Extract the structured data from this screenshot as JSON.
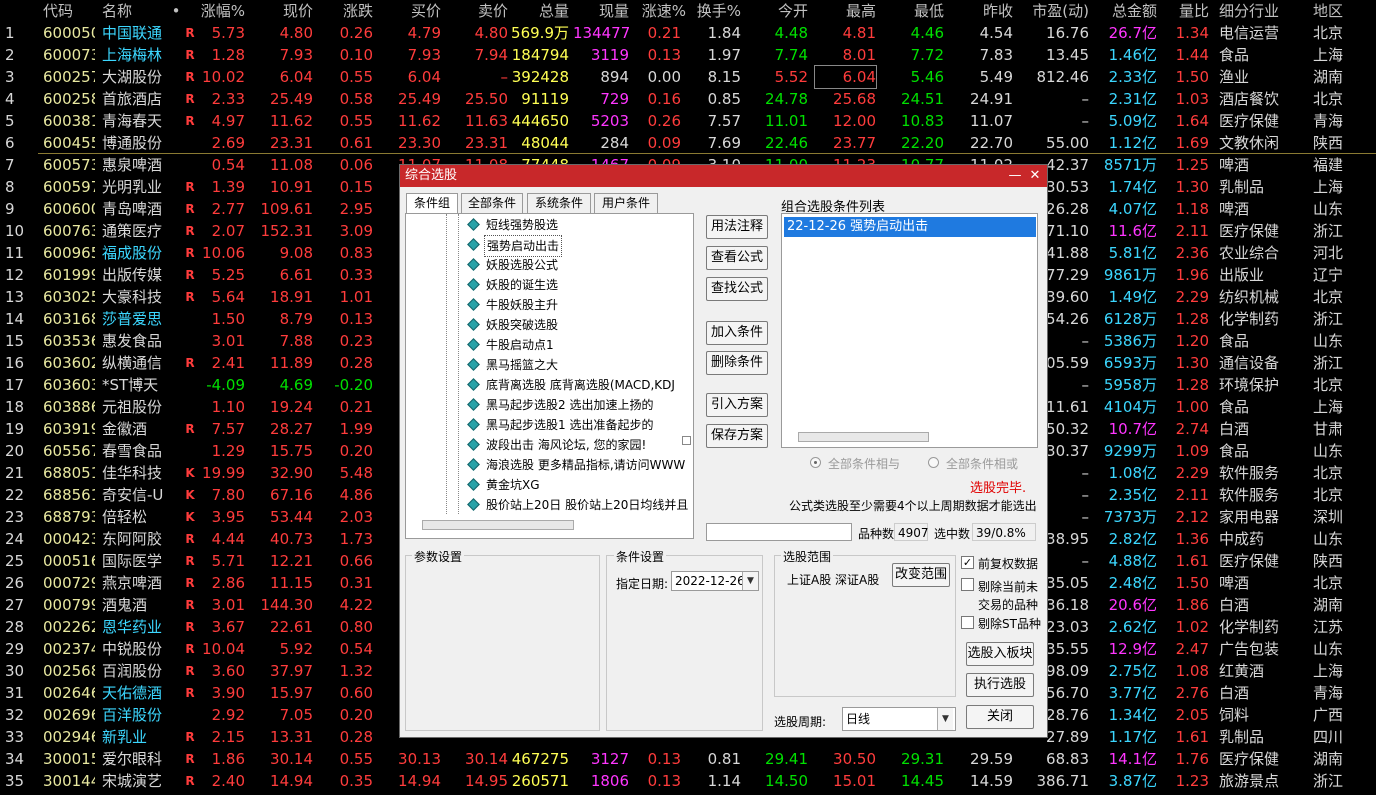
{
  "columns": [
    "代码",
    "名称",
    "•",
    "涨幅%",
    "现价",
    "涨跌",
    "买价",
    "卖价",
    "总量",
    "现量",
    "涨速%",
    "换手%",
    "今开",
    "最高",
    "最低",
    "昨收",
    "市盈(动)",
    "总金额",
    "量比",
    "细分行业",
    "地区"
  ],
  "rows": [
    {
      "n": "1",
      "code": "600050",
      "name": "中国联通",
      "tag": "R",
      "chg": "5.73",
      "price": "4.80",
      "diff": "0.26",
      "bid": "4.79",
      "ask": "4.80",
      "vol": "569.9万",
      "cur": "134477",
      "spd": "0.21",
      "turn": "1.84",
      "open": "4.48",
      "high": "4.81",
      "low": "4.46",
      "prev": "4.54",
      "pe": "16.76",
      "amt": "26.7亿",
      "vr": "1.34",
      "ind": "电信运营",
      "reg": "北京"
    },
    {
      "n": "2",
      "code": "600073",
      "name": "上海梅林",
      "tag": "R",
      "chg": "1.28",
      "price": "7.93",
      "diff": "0.10",
      "bid": "7.93",
      "ask": "7.94",
      "vol": "184794",
      "cur": "3119",
      "spd": "0.13",
      "turn": "1.97",
      "open": "7.74",
      "high": "8.01",
      "low": "7.72",
      "prev": "7.83",
      "pe": "13.45",
      "amt": "1.46亿",
      "vr": "1.44",
      "ind": "食品",
      "reg": "上海"
    },
    {
      "n": "3",
      "code": "600257",
      "name": "大湖股份",
      "tag": "R",
      "chg": "10.02",
      "price": "6.04",
      "diff": "0.55",
      "bid": "6.04",
      "ask": "–",
      "vol": "392428",
      "cur": "894",
      "spd": "0.00",
      "turn": "8.15",
      "open": "5.52",
      "high": "6.04",
      "low": "5.46",
      "prev": "5.49",
      "pe": "812.46",
      "amt": "2.33亿",
      "vr": "1.50",
      "ind": "渔业",
      "reg": "湖南"
    },
    {
      "n": "4",
      "code": "600258",
      "name": "首旅酒店",
      "tag": "R",
      "chg": "2.33",
      "price": "25.49",
      "diff": "0.58",
      "bid": "25.49",
      "ask": "25.50",
      "vol": "91119",
      "cur": "729",
      "spd": "0.16",
      "turn": "0.85",
      "open": "24.78",
      "high": "25.68",
      "low": "24.51",
      "prev": "24.91",
      "pe": "–",
      "amt": "2.31亿",
      "vr": "1.03",
      "ind": "酒店餐饮",
      "reg": "北京"
    },
    {
      "n": "5",
      "code": "600381",
      "name": "青海春天",
      "tag": "R",
      "chg": "4.97",
      "price": "11.62",
      "diff": "0.55",
      "bid": "11.62",
      "ask": "11.63",
      "vol": "444650",
      "cur": "5203",
      "spd": "0.26",
      "turn": "7.57",
      "open": "11.01",
      "high": "12.00",
      "low": "10.83",
      "prev": "11.07",
      "pe": "–",
      "amt": "5.09亿",
      "vr": "1.64",
      "ind": "医疗保健",
      "reg": "青海"
    },
    {
      "n": "6",
      "code": "600455",
      "name": "博通股份",
      "tag": "",
      "chg": "2.69",
      "price": "23.31",
      "diff": "0.61",
      "bid": "23.30",
      "ask": "23.31",
      "vol": "48044",
      "cur": "284",
      "spd": "0.09",
      "turn": "7.69",
      "open": "22.46",
      "high": "23.77",
      "low": "22.20",
      "prev": "22.70",
      "pe": "55.00",
      "amt": "1.12亿",
      "vr": "1.69",
      "ind": "文教休闲",
      "reg": "陕西"
    },
    {
      "n": "7",
      "code": "600573",
      "name": "惠泉啤酒",
      "tag": "",
      "chg": "0.54",
      "price": "11.08",
      "diff": "0.06",
      "bid": "11.07",
      "ask": "11.08",
      "vol": "77448",
      "cur": "1467",
      "spd": "0.09",
      "turn": "3.10",
      "open": "11.00",
      "high": "11.23",
      "low": "10.77",
      "prev": "11.02",
      "pe": "42.37",
      "amt": "8571万",
      "vr": "1.25",
      "ind": "啤酒",
      "reg": "福建"
    },
    {
      "n": "8",
      "code": "600597",
      "name": "光明乳业",
      "tag": "R",
      "chg": "1.39",
      "price": "10.91",
      "diff": "0.15",
      "bid": "",
      "ask": "",
      "vol": "",
      "cur": "",
      "spd": "",
      "turn": "",
      "open": "",
      "high": "",
      "low": "",
      "prev": "",
      "pe": "30.53",
      "amt": "1.74亿",
      "vr": "1.30",
      "ind": "乳制品",
      "reg": "上海"
    },
    {
      "n": "9",
      "code": "600600",
      "name": "青岛啤酒",
      "tag": "R",
      "chg": "2.77",
      "price": "109.61",
      "diff": "2.95",
      "bid": "",
      "ask": "",
      "vol": "",
      "cur": "",
      "spd": "",
      "turn": "",
      "open": "",
      "high": "",
      "low": "",
      "prev": "",
      "pe": "26.28",
      "amt": "4.07亿",
      "vr": "1.18",
      "ind": "啤酒",
      "reg": "山东"
    },
    {
      "n": "10",
      "code": "600763",
      "name": "通策医疗",
      "tag": "R",
      "chg": "2.07",
      "price": "152.31",
      "diff": "3.09",
      "bid": "",
      "ask": "",
      "vol": "",
      "cur": "",
      "spd": "",
      "turn": "",
      "open": "",
      "high": "",
      "low": "",
      "prev": "",
      "pe": "71.10",
      "amt": "11.6亿",
      "vr": "2.11",
      "ind": "医疗保健",
      "reg": "浙江"
    },
    {
      "n": "11",
      "code": "600965",
      "name": "福成股份",
      "tag": "R",
      "chg": "10.06",
      "price": "9.08",
      "diff": "0.83",
      "bid": "",
      "ask": "",
      "vol": "",
      "cur": "",
      "spd": "",
      "turn": "",
      "open": "",
      "high": "",
      "low": "",
      "prev": "",
      "pe": "41.88",
      "amt": "5.81亿",
      "vr": "2.36",
      "ind": "农业综合",
      "reg": "河北"
    },
    {
      "n": "12",
      "code": "601999",
      "name": "出版传媒",
      "tag": "R",
      "chg": "5.25",
      "price": "6.61",
      "diff": "0.33",
      "bid": "",
      "ask": "",
      "vol": "",
      "cur": "",
      "spd": "",
      "turn": "",
      "open": "",
      "high": "",
      "low": "",
      "prev": "",
      "pe": "77.29",
      "amt": "9861万",
      "vr": "1.96",
      "ind": "出版业",
      "reg": "辽宁"
    },
    {
      "n": "13",
      "code": "603025",
      "name": "大豪科技",
      "tag": "R",
      "chg": "5.64",
      "price": "18.91",
      "diff": "1.01",
      "bid": "",
      "ask": "",
      "vol": "",
      "cur": "",
      "spd": "",
      "turn": "",
      "open": "",
      "high": "",
      "low": "",
      "prev": "",
      "pe": "39.60",
      "amt": "1.49亿",
      "vr": "2.29",
      "ind": "纺织机械",
      "reg": "北京"
    },
    {
      "n": "14",
      "code": "603168",
      "name": "莎普爱思",
      "tag": "",
      "chg": "1.50",
      "price": "8.79",
      "diff": "0.13",
      "bid": "",
      "ask": "",
      "vol": "",
      "cur": "",
      "spd": "",
      "turn": "",
      "open": "",
      "high": "",
      "low": "",
      "prev": "",
      "pe": "54.26",
      "amt": "6128万",
      "vr": "1.28",
      "ind": "化学制药",
      "reg": "浙江"
    },
    {
      "n": "15",
      "code": "603536",
      "name": "惠发食品",
      "tag": "",
      "chg": "3.01",
      "price": "7.88",
      "diff": "0.23",
      "bid": "",
      "ask": "",
      "vol": "",
      "cur": "",
      "spd": "",
      "turn": "",
      "open": "",
      "high": "",
      "low": "",
      "prev": "",
      "pe": "–",
      "amt": "5386万",
      "vr": "1.20",
      "ind": "食品",
      "reg": "山东"
    },
    {
      "n": "16",
      "code": "603602",
      "name": "纵横通信",
      "tag": "R",
      "chg": "2.41",
      "price": "11.89",
      "diff": "0.28",
      "bid": "",
      "ask": "",
      "vol": "",
      "cur": "",
      "spd": "",
      "turn": "",
      "open": "",
      "high": "",
      "low": "",
      "prev": "",
      "pe": "105.59",
      "amt": "6593万",
      "vr": "1.30",
      "ind": "通信设备",
      "reg": "浙江"
    },
    {
      "n": "17",
      "code": "603603",
      "name": "*ST博天",
      "tag": "",
      "chg": "-4.09",
      "price": "4.69",
      "diff": "-0.20",
      "bid": "",
      "ask": "",
      "vol": "",
      "cur": "",
      "spd": "",
      "turn": "",
      "open": "",
      "high": "",
      "low": "",
      "prev": "",
      "pe": "–",
      "amt": "5958万",
      "vr": "1.28",
      "ind": "环境保护",
      "reg": "北京"
    },
    {
      "n": "18",
      "code": "603886",
      "name": "元祖股份",
      "tag": "",
      "chg": "1.10",
      "price": "19.24",
      "diff": "0.21",
      "bid": "",
      "ask": "",
      "vol": "",
      "cur": "",
      "spd": "",
      "turn": "",
      "open": "",
      "high": "",
      "low": "",
      "prev": "",
      "pe": "11.61",
      "amt": "4104万",
      "vr": "1.00",
      "ind": "食品",
      "reg": "上海"
    },
    {
      "n": "19",
      "code": "603919",
      "name": "金徽酒",
      "tag": "R",
      "chg": "7.57",
      "price": "28.27",
      "diff": "1.99",
      "bid": "",
      "ask": "",
      "vol": "",
      "cur": "",
      "spd": "",
      "turn": "",
      "open": "",
      "high": "",
      "low": "",
      "prev": "",
      "pe": "50.32",
      "amt": "10.7亿",
      "vr": "2.74",
      "ind": "白酒",
      "reg": "甘肃"
    },
    {
      "n": "20",
      "code": "605567",
      "name": "春雪食品",
      "tag": "",
      "chg": "1.29",
      "price": "15.75",
      "diff": "0.20",
      "bid": "",
      "ask": "",
      "vol": "",
      "cur": "",
      "spd": "",
      "turn": "",
      "open": "",
      "high": "",
      "low": "",
      "prev": "",
      "pe": "30.37",
      "amt": "9299万",
      "vr": "1.09",
      "ind": "食品",
      "reg": "山东"
    },
    {
      "n": "21",
      "code": "688051",
      "name": "佳华科技",
      "tag": "K",
      "chg": "19.99",
      "price": "32.90",
      "diff": "5.48",
      "bid": "",
      "ask": "",
      "vol": "",
      "cur": "",
      "spd": "",
      "turn": "",
      "open": "",
      "high": "",
      "low": "",
      "prev": "",
      "pe": "–",
      "amt": "1.08亿",
      "vr": "2.29",
      "ind": "软件服务",
      "reg": "北京"
    },
    {
      "n": "22",
      "code": "688561",
      "name": "奇安信-U",
      "tag": "K",
      "chg": "7.80",
      "price": "67.16",
      "diff": "4.86",
      "bid": "",
      "ask": "",
      "vol": "",
      "cur": "",
      "spd": "",
      "turn": "",
      "open": "",
      "high": "",
      "low": "",
      "prev": "",
      "pe": "–",
      "amt": "2.35亿",
      "vr": "2.11",
      "ind": "软件服务",
      "reg": "北京"
    },
    {
      "n": "23",
      "code": "688793",
      "name": "倍轻松",
      "tag": "K",
      "chg": "3.95",
      "price": "53.44",
      "diff": "2.03",
      "bid": "",
      "ask": "",
      "vol": "",
      "cur": "",
      "spd": "",
      "turn": "",
      "open": "",
      "high": "",
      "low": "",
      "prev": "",
      "pe": "–",
      "amt": "7373万",
      "vr": "2.12",
      "ind": "家用电器",
      "reg": "深圳"
    },
    {
      "n": "24",
      "code": "000423",
      "name": "东阿阿胶",
      "tag": "R",
      "chg": "4.44",
      "price": "40.73",
      "diff": "1.73",
      "bid": "",
      "ask": "",
      "vol": "",
      "cur": "",
      "spd": "",
      "turn": "",
      "open": "",
      "high": "",
      "low": "",
      "prev": "",
      "pe": "38.95",
      "amt": "2.82亿",
      "vr": "1.36",
      "ind": "中成药",
      "reg": "山东"
    },
    {
      "n": "25",
      "code": "000516",
      "name": "国际医学",
      "tag": "R",
      "chg": "5.71",
      "price": "12.21",
      "diff": "0.66",
      "bid": "",
      "ask": "",
      "vol": "",
      "cur": "",
      "spd": "",
      "turn": "",
      "open": "",
      "high": "",
      "low": "",
      "prev": "",
      "pe": "–",
      "amt": "4.88亿",
      "vr": "1.61",
      "ind": "医疗保健",
      "reg": "陕西"
    },
    {
      "n": "26",
      "code": "000729",
      "name": "燕京啤酒",
      "tag": "R",
      "chg": "2.86",
      "price": "11.15",
      "diff": "0.31",
      "bid": "",
      "ask": "",
      "vol": "",
      "cur": "",
      "spd": "",
      "turn": "",
      "open": "",
      "high": "",
      "low": "",
      "prev": "",
      "pe": "35.05",
      "amt": "2.48亿",
      "vr": "1.50",
      "ind": "啤酒",
      "reg": "北京"
    },
    {
      "n": "27",
      "code": "000799",
      "name": "酒鬼酒",
      "tag": "R",
      "chg": "3.01",
      "price": "144.30",
      "diff": "4.22",
      "bid": "",
      "ask": "",
      "vol": "",
      "cur": "",
      "spd": "",
      "turn": "",
      "open": "",
      "high": "",
      "low": "",
      "prev": "",
      "pe": "36.18",
      "amt": "20.6亿",
      "vr": "1.86",
      "ind": "白酒",
      "reg": "湖南"
    },
    {
      "n": "28",
      "code": "002262",
      "name": "恩华药业",
      "tag": "R",
      "chg": "3.67",
      "price": "22.61",
      "diff": "0.80",
      "bid": "",
      "ask": "",
      "vol": "",
      "cur": "",
      "spd": "",
      "turn": "",
      "open": "",
      "high": "",
      "low": "",
      "prev": "",
      "pe": "23.03",
      "amt": "2.62亿",
      "vr": "1.02",
      "ind": "化学制药",
      "reg": "江苏"
    },
    {
      "n": "29",
      "code": "002374",
      "name": "中锐股份",
      "tag": "R",
      "chg": "10.04",
      "price": "5.92",
      "diff": "0.54",
      "bid": "",
      "ask": "",
      "vol": "",
      "cur": "",
      "spd": "",
      "turn": "",
      "open": "",
      "high": "",
      "low": "",
      "prev": "",
      "pe": "235.55",
      "amt": "12.9亿",
      "vr": "2.47",
      "ind": "广告包装",
      "reg": "山东"
    },
    {
      "n": "30",
      "code": "002568",
      "name": "百润股份",
      "tag": "R",
      "chg": "3.60",
      "price": "37.97",
      "diff": "1.32",
      "bid": "",
      "ask": "",
      "vol": "",
      "cur": "",
      "spd": "",
      "turn": "",
      "open": "",
      "high": "",
      "low": "",
      "prev": "",
      "pe": "98.09",
      "amt": "2.75亿",
      "vr": "1.08",
      "ind": "红黄酒",
      "reg": "上海"
    },
    {
      "n": "31",
      "code": "002646",
      "name": "天佑德酒",
      "tag": "R",
      "chg": "3.90",
      "price": "15.97",
      "diff": "0.60",
      "bid": "",
      "ask": "",
      "vol": "",
      "cur": "",
      "spd": "",
      "turn": "",
      "open": "",
      "high": "",
      "low": "",
      "prev": "",
      "pe": "56.70",
      "amt": "3.77亿",
      "vr": "2.76",
      "ind": "白酒",
      "reg": "青海"
    },
    {
      "n": "32",
      "code": "002696",
      "name": "百洋股份",
      "tag": "",
      "chg": "2.92",
      "price": "7.05",
      "diff": "0.20",
      "bid": "",
      "ask": "",
      "vol": "",
      "cur": "",
      "spd": "",
      "turn": "",
      "open": "",
      "high": "",
      "low": "",
      "prev": "",
      "pe": "28.76",
      "amt": "1.34亿",
      "vr": "2.05",
      "ind": "饲料",
      "reg": "广西"
    },
    {
      "n": "33",
      "code": "002946",
      "name": "新乳业",
      "tag": "R",
      "chg": "2.15",
      "price": "13.31",
      "diff": "0.28",
      "bid": "",
      "ask": "",
      "vol": "",
      "cur": "",
      "spd": "",
      "turn": "",
      "open": "",
      "high": "",
      "low": "",
      "prev": "",
      "pe": "27.89",
      "amt": "1.17亿",
      "vr": "1.61",
      "ind": "乳制品",
      "reg": "四川"
    },
    {
      "n": "34",
      "code": "300015",
      "name": "爱尔眼科",
      "tag": "R",
      "chg": "1.86",
      "price": "30.14",
      "diff": "0.55",
      "bid": "30.13",
      "ask": "30.14",
      "vol": "467275",
      "cur": "3127",
      "spd": "0.13",
      "turn": "0.81",
      "open": "29.41",
      "high": "30.50",
      "low": "29.31",
      "prev": "29.59",
      "pe": "68.83",
      "amt": "14.1亿",
      "vr": "1.76",
      "ind": "医疗保健",
      "reg": "湖南"
    },
    {
      "n": "35",
      "code": "300144",
      "name": "宋城演艺",
      "tag": "R",
      "chg": "2.40",
      "price": "14.94",
      "diff": "0.35",
      "bid": "14.94",
      "ask": "14.95",
      "vol": "260571",
      "cur": "1806",
      "spd": "0.13",
      "turn": "1.14",
      "open": "14.50",
      "high": "15.01",
      "low": "14.45",
      "prev": "14.59",
      "pe": "386.71",
      "amt": "3.87亿",
      "vr": "1.23",
      "ind": "旅游景点",
      "reg": "浙江"
    }
  ],
  "dialog": {
    "title": "综合选股",
    "min_icon": "minimize-icon",
    "close_icon": "close-icon",
    "tabs": [
      "条件组",
      "全部条件",
      "系统条件",
      "用户条件"
    ],
    "tree_items": [
      "短线强势股选",
      "强势启动出击",
      "妖股选股公式",
      "妖股的诞生选",
      "牛股妖股主升",
      "妖股突破选股",
      "牛股启动点1",
      "黑马摇篮之大",
      "底背离选股  底背离选股(MACD,KDJ",
      "黑马起步选股2 选出加速上扬的",
      "黑马起步选股1 选出准备起步的",
      "波段出击 海风论坛, 您的家园!",
      "海浪选股 更多精品指标,请访问WWW",
      "黄金坑XG",
      "股价站上20日 股价站上20日均线并且"
    ],
    "buttons": {
      "usage": "用法注释",
      "view_formula": "查看公式",
      "find_formula": "查找公式",
      "add_cond": "加入条件",
      "del_cond": "删除条件",
      "import_plan": "引入方案",
      "save_plan": "保存方案",
      "change_range": "改变范围",
      "to_block": "选股入板块",
      "execute": "执行选股",
      "close": "关闭"
    },
    "combo_list_label": "组合选股条件列表",
    "combo_items": [
      "22-12-26 强势启动出击"
    ],
    "radio_and": "全部条件相与",
    "radio_or": "全部条件相或",
    "status": "选股完毕.",
    "note": "公式类选股至少需要4个以上周期数据才能选出",
    "count_label": "品种数",
    "count_value": "4907",
    "selected_label": "选中数",
    "selected_value": "39/0.8%",
    "param_label": "参数设置",
    "cond_setting_label": "条件设置",
    "date_label": "指定日期:",
    "date_value": "2022-12-26",
    "range_label": "选股范围",
    "range_value": "上证A股 深证A股",
    "chk_rights": "前复权数据",
    "chk_rights_on": true,
    "chk_untraded_1": "剔除当前未",
    "chk_untraded_2": "交易的品种",
    "chk_st": "剔除ST品种",
    "period_label": "选股周期:",
    "period_value": "日线"
  }
}
